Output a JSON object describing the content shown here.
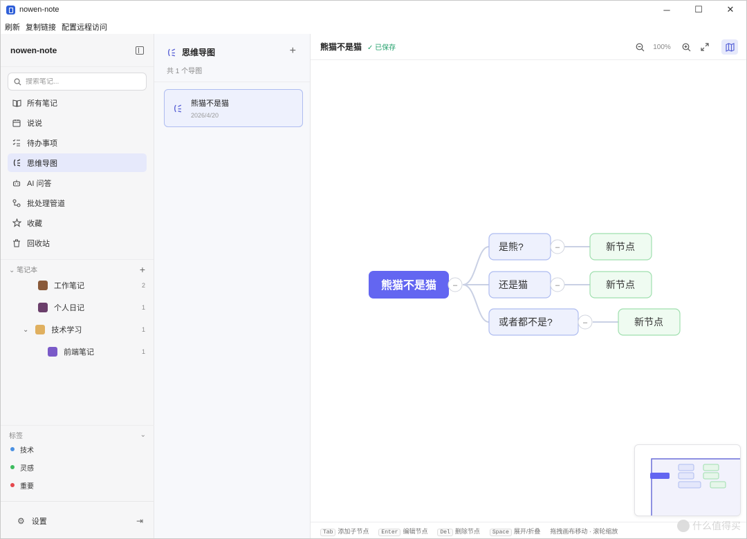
{
  "window": {
    "title": "nowen-note",
    "min": "─",
    "max": "☐",
    "close": "✕"
  },
  "menu": [
    "刷新",
    "复制链接",
    "配置远程访问"
  ],
  "sidebar": {
    "app_name": "nowen-note",
    "search_placeholder": "搜索笔记...",
    "nav": [
      {
        "label": "所有笔记",
        "icon": "book-icon"
      },
      {
        "label": "说说",
        "icon": "calendar-icon"
      },
      {
        "label": "待办事项",
        "icon": "checklist-icon"
      },
      {
        "label": "思维导图",
        "icon": "mindmap-icon"
      },
      {
        "label": "AI 问答",
        "icon": "robot-icon"
      },
      {
        "label": "批处理管道",
        "icon": "pipeline-icon"
      },
      {
        "label": "收藏",
        "icon": "star-icon"
      },
      {
        "label": "回收站",
        "icon": "trash-icon"
      }
    ],
    "notebooks_label": "笔记本",
    "notebooks": [
      {
        "label": "工作笔记",
        "count": "2"
      },
      {
        "label": "个人日记",
        "count": "1"
      },
      {
        "label": "技术学习",
        "count": "1"
      },
      {
        "label": "前端笔记",
        "count": "1"
      }
    ],
    "tags_label": "标签",
    "tags": [
      {
        "label": "技术",
        "color": "#4a90e2"
      },
      {
        "label": "灵感",
        "color": "#3dbb5e"
      },
      {
        "label": "重要",
        "color": "#e5484d"
      }
    ],
    "settings_label": "设置"
  },
  "list": {
    "title": "思维导图",
    "subtitle": "共 1 个导图",
    "items": [
      {
        "title": "熊猫不是猫",
        "date": "2026/4/20"
      }
    ]
  },
  "main": {
    "doc_title": "熊猫不是猫",
    "saved": "✓ 已保存",
    "zoom": "100%",
    "hints": [
      {
        "key": "Tab",
        "text": "添加子节点"
      },
      {
        "key": "Enter",
        "text": "编辑节点"
      },
      {
        "key": "Del",
        "text": "删除节点"
      },
      {
        "key": "Space",
        "text": "展开/折叠"
      }
    ],
    "hint_drag": "拖拽画布移动 · 滚轮缩放"
  },
  "mindmap": {
    "root": "熊猫不是猫",
    "branches": [
      {
        "label": "是熊?",
        "child": "新节点"
      },
      {
        "label": "还是猫",
        "child": "新节点"
      },
      {
        "label": "或者都不是?",
        "child": "新节点"
      }
    ],
    "collapse_symbol": "–"
  },
  "watermark": "什么值得买"
}
